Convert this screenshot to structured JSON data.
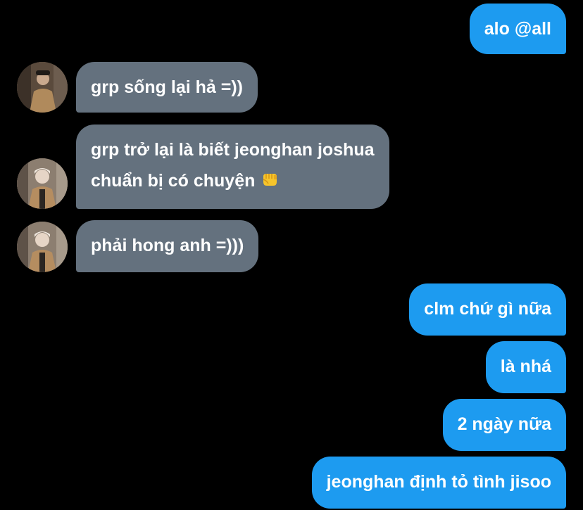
{
  "conversation": {
    "messages": [
      {
        "id": "m1",
        "direction": "outgoing",
        "text": "alo @all"
      },
      {
        "id": "m2",
        "direction": "incoming",
        "text": "grp sống lại hả =))",
        "avatar": "user-avatar-1"
      },
      {
        "id": "m3",
        "direction": "incoming",
        "line1": "grp trở lại là biết jeonghan joshua",
        "line2": "chuẩn bị có chuyện",
        "emoji": "oncoming-fist-emoji",
        "avatar": "user-avatar-2"
      },
      {
        "id": "m4",
        "direction": "incoming",
        "text": "phải hong anh =)))",
        "avatar": "user-avatar-2"
      },
      {
        "id": "m5",
        "direction": "outgoing",
        "text": "clm chứ gì nữa"
      },
      {
        "id": "m6",
        "direction": "outgoing",
        "text": "là nhá"
      },
      {
        "id": "m7",
        "direction": "outgoing",
        "text": "2 ngày nữa"
      },
      {
        "id": "m8",
        "direction": "outgoing",
        "text": "jeonghan định tỏ tình jisoo"
      }
    ]
  },
  "colors": {
    "background": "#000000",
    "outgoing_bubble": "#1d9bf0",
    "incoming_bubble": "#64717e",
    "text": "#ffffff"
  }
}
